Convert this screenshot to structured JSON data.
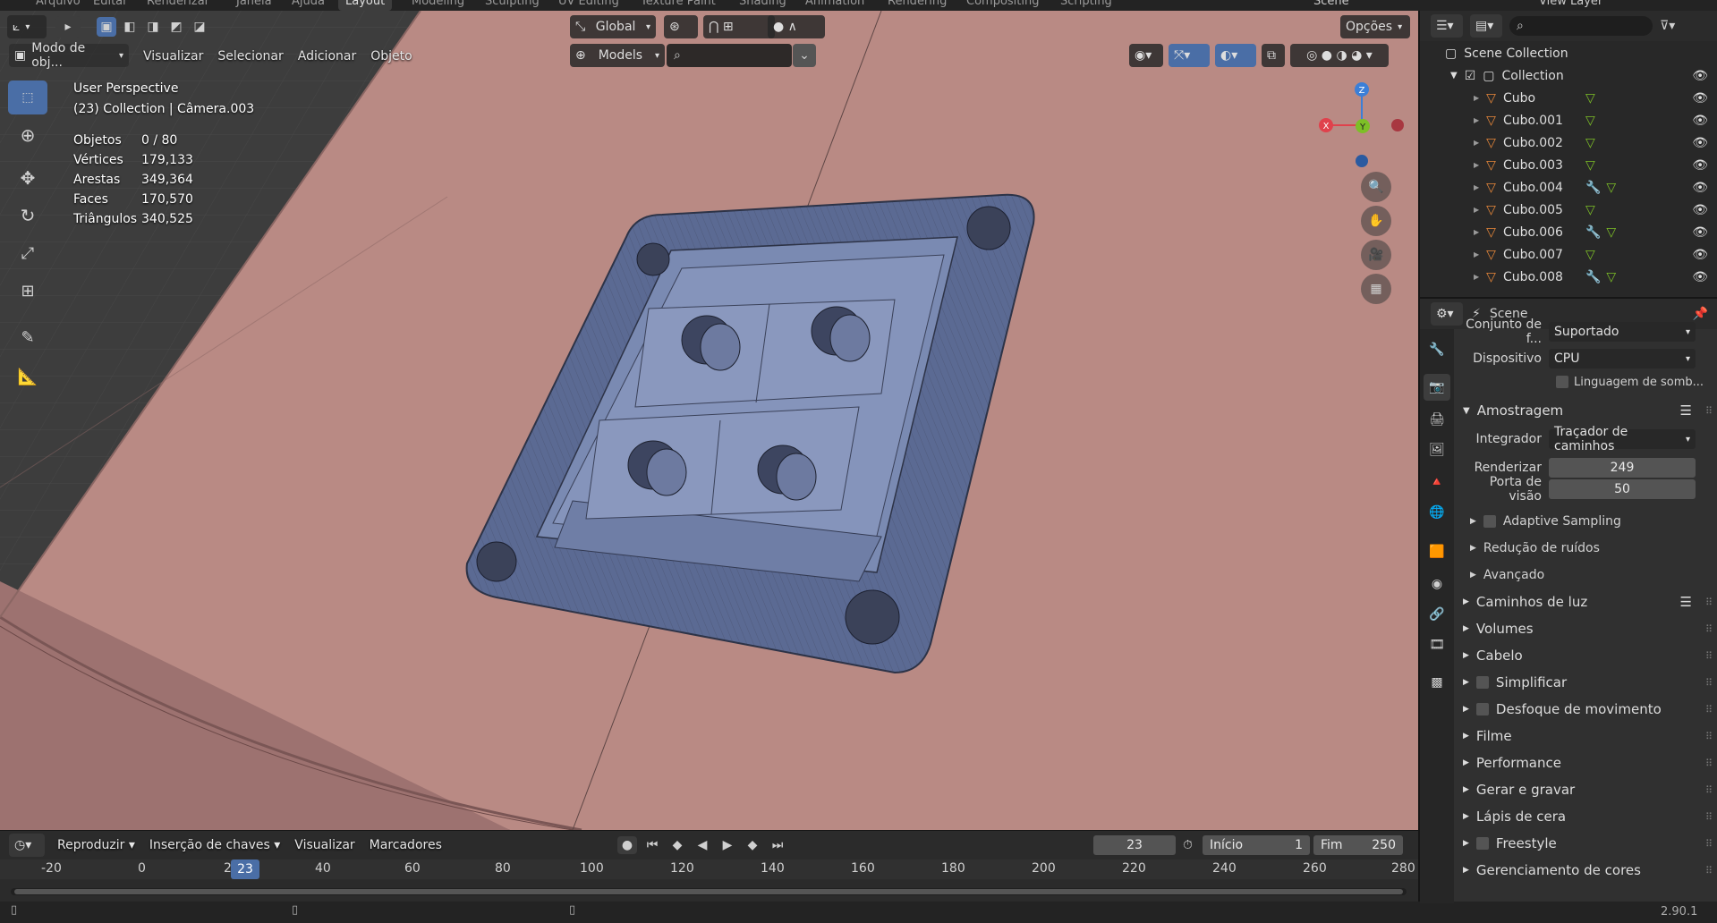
{
  "colors": {
    "accent": "#4a6ea6",
    "viewport_bg": "#b98a84",
    "mesh": "#7482a8",
    "header": "#282828",
    "x_axis": "#e0414c",
    "y_axis": "#7dbf27",
    "z_axis": "#3b7fd8"
  },
  "workspaces": [
    "Layout",
    "Modeling",
    "Sculpting",
    "UV Editing",
    "Texture Paint",
    "Shading",
    "Animation",
    "Rendering",
    "Compositing",
    "Scripting"
  ],
  "topmenu": [
    "Arquivo",
    "Editar",
    "Renderizar",
    "Janela",
    "Ajuda"
  ],
  "scene_name": "Scene",
  "view_layer": "View Layer",
  "viewport": {
    "transform_orientation": "Global",
    "options": "Opções",
    "mode": "Modo de obj...",
    "menus": [
      "Visualizar",
      "Selecionar",
      "Adicionar",
      "Objeto"
    ],
    "asset_dropdown": "Models",
    "perspective": "User Perspective",
    "context": "(23) Collection | Câmera.003",
    "stats": [
      {
        "label": "Objetos",
        "value": "0 / 80"
      },
      {
        "label": "Vértices",
        "value": "179,133"
      },
      {
        "label": "Arestas",
        "value": "349,364"
      },
      {
        "label": "Faces",
        "value": "170,570"
      },
      {
        "label": "Triângulos",
        "value": "340,525"
      }
    ],
    "gizmo": {
      "x": "X",
      "y": "Y",
      "z": "Z"
    }
  },
  "timeline": {
    "menus": [
      "Reproduzir",
      "Inserção de chaves",
      "Visualizar",
      "Marcadores"
    ],
    "current_frame": "23",
    "start_label": "Início",
    "start": "1",
    "end_label": "Fim",
    "end": "250",
    "ruler": [
      "-20",
      "0",
      "20",
      "40",
      "60",
      "80",
      "100",
      "120",
      "140",
      "160",
      "180",
      "200",
      "220",
      "240",
      "260",
      "280"
    ]
  },
  "outliner": {
    "root": "Scene Collection",
    "collection": "Collection",
    "items": [
      {
        "name": "Cubo",
        "modifier": false
      },
      {
        "name": "Cubo.001",
        "modifier": false
      },
      {
        "name": "Cubo.002",
        "modifier": false
      },
      {
        "name": "Cubo.003",
        "modifier": false
      },
      {
        "name": "Cubo.004",
        "modifier": true
      },
      {
        "name": "Cubo.005",
        "modifier": false
      },
      {
        "name": "Cubo.006",
        "modifier": true
      },
      {
        "name": "Cubo.007",
        "modifier": false
      },
      {
        "name": "Cubo.008",
        "modifier": true
      }
    ]
  },
  "properties": {
    "title": "Scene",
    "feature_set_label": "Conjunto de f...",
    "feature_set": "Suportado",
    "device_label": "Dispositivo",
    "device": "CPU",
    "osl_label": "Linguagem de somb...",
    "sampling": "Amostragem",
    "integrator_label": "Integrador",
    "integrator": "Traçador de caminhos",
    "render_label": "Renderizar",
    "render": "249",
    "viewport_label": "Porta de visão",
    "viewport_samples": "50",
    "sub": [
      "Adaptive Sampling",
      "Redução de ruídos",
      "Avançado"
    ],
    "sections": [
      {
        "label": "Caminhos de luz",
        "check": false
      },
      {
        "label": "Volumes",
        "check": false
      },
      {
        "label": "Cabelo",
        "check": false
      },
      {
        "label": "Simplificar",
        "check": true
      },
      {
        "label": "Desfoque de movimento",
        "check": true
      },
      {
        "label": "Filme",
        "check": false
      },
      {
        "label": "Performance",
        "check": false
      },
      {
        "label": "Gerar e gravar",
        "check": false
      },
      {
        "label": "Lápis de cera",
        "check": false
      },
      {
        "label": "Freestyle",
        "check": true
      },
      {
        "label": "Gerenciamento de cores",
        "check": false
      }
    ]
  },
  "version": "2.90.1"
}
